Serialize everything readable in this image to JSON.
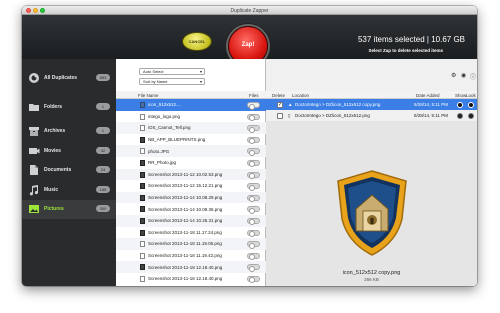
{
  "window": {
    "title": "Duplicate Zapper"
  },
  "header": {
    "cancel_label": "CANCEL",
    "zap_label": "Zap!",
    "selection_summary": "537 items selected | 10.67 GB",
    "selection_hint": "Select Zap to delete selected items"
  },
  "sidebar": {
    "items": [
      {
        "label": "All Duplicates",
        "count": "553",
        "icon": "duplicates-icon"
      },
      {
        "label": "Folders",
        "count": "1",
        "icon": "folder-icon"
      },
      {
        "label": "Archives",
        "count": "1",
        "icon": "archive-icon"
      },
      {
        "label": "Movies",
        "count": "42",
        "icon": "movie-icon"
      },
      {
        "label": "Documents",
        "count": "24",
        "icon": "document-icon"
      },
      {
        "label": "Music",
        "count": "185",
        "icon": "music-icon"
      },
      {
        "label": "Pictures",
        "count": "300",
        "icon": "pictures-icon"
      }
    ],
    "active": "Pictures"
  },
  "files": {
    "auto_select": "Auto Select",
    "sort": "Sort by Name",
    "col_file_name": "File Name",
    "col_files": "Files",
    "rows": [
      "icon_512x512....",
      "intego_logo.png",
      "iOS_Cannot_Tell.png",
      "NB_APP_BLUEPRINTS.png",
      "photo.JPG",
      "RR_Photo.jpg",
      "Screenshot 2013-11-12 10.02.53.png",
      "Screenshot 2013-11-12 15.12.21.png",
      "Screenshot 2013-11-14 10.08.29.png",
      "Screenshot 2013-11-14 10.08.36.png",
      "Screenshot 2013-11-14 10.25.31.png",
      "Screenshot 2013-11-18 11.17.24.png",
      "Screenshot 2013-11-18 11.19.05.png",
      "Screenshot 2013-11-18 11.19.42.png",
      "Screenshot 2013-11-18 12.18.40.png",
      "Screenshot 2013-11-18 12.18.40.png"
    ]
  },
  "duplicates": {
    "col_delete": "Delete",
    "col_location": "Location",
    "col_date_added": "Date Added",
    "col_show": "Show",
    "col_look": "Look",
    "rows": [
      {
        "location": "DoctorIntego > DZ/icon_512x512 copy.png",
        "date": "5/28/14, 5:11 PM",
        "checked": "✓"
      },
      {
        "location": "DoctorIntego > DZ/icon_512x512.png",
        "date": "5/28/14, 5:11 PM",
        "checked": ""
      }
    ]
  },
  "preview": {
    "file_name": "icon_512x512 copy.png",
    "file_size": "266 KB"
  },
  "colors": {
    "selection_blue": "#3b7ee6",
    "sidebar_bg": "#2a2b2d",
    "active_green": "#9ee53b",
    "zap_red": "#d8140e",
    "cancel_yellow": "#c5c01e"
  }
}
